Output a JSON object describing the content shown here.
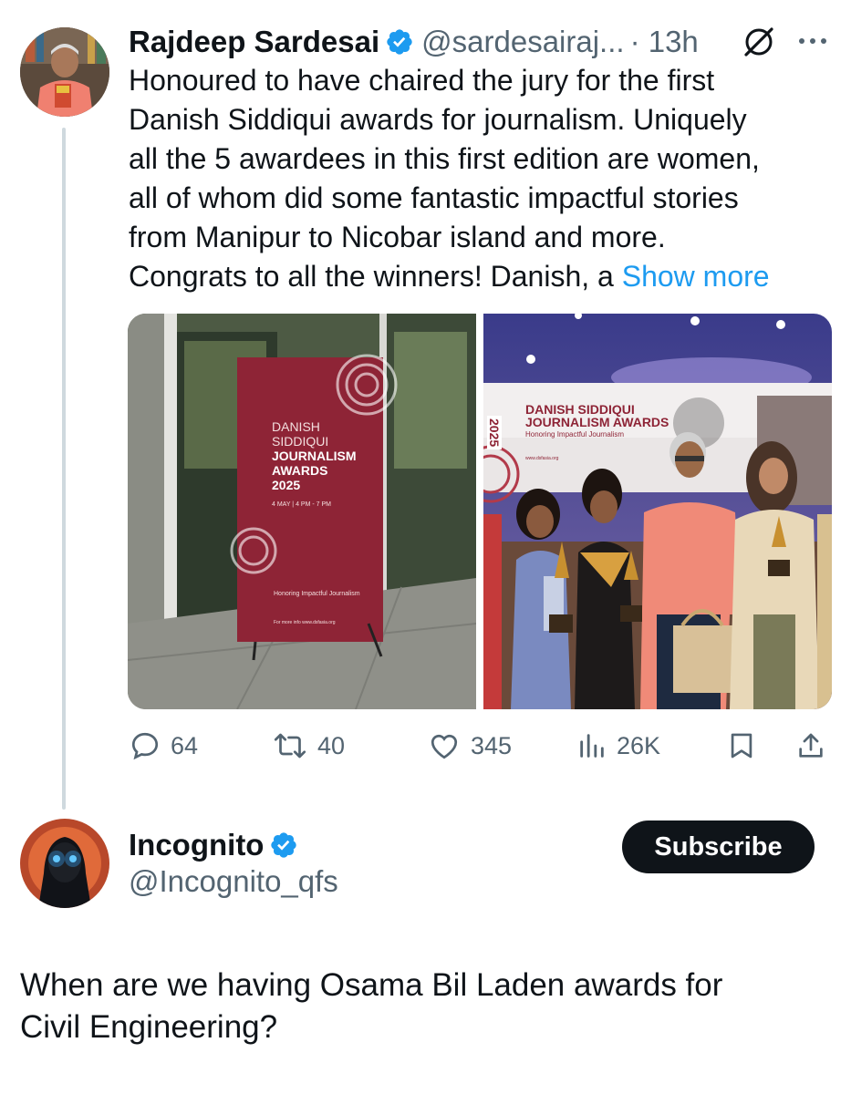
{
  "tweet": {
    "author_name": "Rajdeep Sardesai",
    "author_handle": "@sardesairaj...",
    "time": "· 13h",
    "text_lines": [
      "Honoured to have chaired the jury for the first",
      "Danish Siddiqui awards for journalism. Uniquely",
      "all the 5 awardees in this first edition are women,",
      "all of whom did some fantastic impactful stories",
      "from Manipur to Nicobar island and more.",
      "Congrats to all the winners! Danish, a"
    ],
    "show_more": "Show more",
    "image_left": {
      "banner_lines": [
        "DANISH",
        "SIDDIQUI"
      ],
      "banner_bold": [
        "JOURNALISM",
        "AWARDS",
        "2025"
      ],
      "banner_date": "4 MAY | 4 PM - 7 PM",
      "banner_tagline": "Honoring Impactful Journalism",
      "banner_footer": "For more info www.dsfasia.org"
    },
    "image_right": {
      "backdrop_year": "2025",
      "backdrop_title_1": "DANISH SIDDIQUI",
      "backdrop_title_2": "JOURNALISM AWARDS",
      "backdrop_tagline": "Honoring Impactful Journalism",
      "backdrop_url": "www.dsfasia.org"
    },
    "metrics": {
      "replies": "64",
      "reposts": "40",
      "likes": "345",
      "views": "26K"
    }
  },
  "reply": {
    "author_name": "Incognito",
    "author_handle": "@Incognito_qfs",
    "subscribe_label": "Subscribe",
    "text_lines": [
      "When are we having Osama Bil Laden awards for",
      "Civil Engineering?"
    ]
  },
  "colors": {
    "accent": "#1d9bf0",
    "text": "#0f1419",
    "secondary": "#536471",
    "banner": "#8e2436"
  }
}
